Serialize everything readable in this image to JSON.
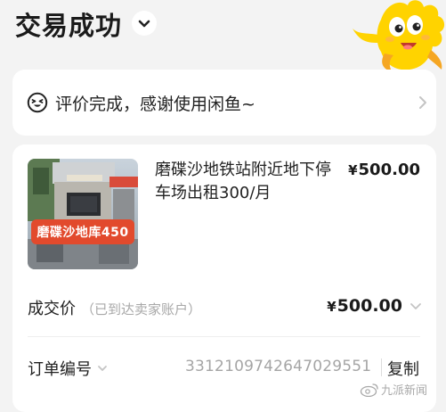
{
  "header": {
    "title": "交易成功"
  },
  "review": {
    "text": "评价完成，感谢使用闲鱼~"
  },
  "product": {
    "image_label": "磨碟沙地库450",
    "title": "磨碟沙地铁站附近地下停车场出租300/月",
    "currency": "¥",
    "price": "500.00"
  },
  "deal": {
    "label": "成交价",
    "note": "（已到达卖家账户）",
    "currency": "¥",
    "price": "500.00"
  },
  "order": {
    "label": "订单编号",
    "number": "3312109742647029551",
    "copy_label": "复制"
  },
  "watermark": {
    "text": "九派新闻"
  },
  "colors": {
    "page_bg": "#f3f3f3",
    "card_bg": "#ffffff",
    "text_primary": "#1f1f1f",
    "text_secondary": "#a8a8a8",
    "image_label_bg": "#e24a2d",
    "mascot_yellow": "#ffd300"
  }
}
